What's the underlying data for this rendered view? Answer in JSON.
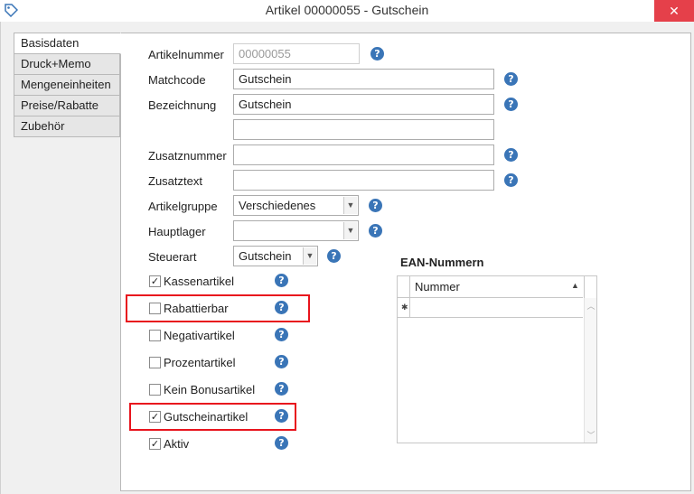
{
  "window": {
    "title": "Artikel 00000055 - Gutschein",
    "close_label": "✕"
  },
  "tabs": [
    {
      "label": "Basisdaten"
    },
    {
      "label": "Druck+Memo"
    },
    {
      "label": "Mengeneinheiten"
    },
    {
      "label": "Preise/Rabatte"
    },
    {
      "label": "Zubehör"
    }
  ],
  "form": {
    "artikelnummer": {
      "label": "Artikelnummer",
      "value": "00000055"
    },
    "matchcode": {
      "label": "Matchcode",
      "value": "Gutschein"
    },
    "bezeichnung": {
      "label": "Bezeichnung",
      "value": "Gutschein",
      "value2": ""
    },
    "zusatznummer": {
      "label": "Zusatznummer",
      "value": ""
    },
    "zusatztext": {
      "label": "Zusatztext",
      "value": ""
    },
    "artikelgruppe": {
      "label": "Artikelgruppe",
      "value": "Verschiedenes"
    },
    "hauptlager": {
      "label": "Hauptlager",
      "value": ""
    },
    "steuerart": {
      "label": "Steuerart",
      "value": "Gutschein"
    }
  },
  "checkboxes": [
    {
      "label": "Kassenartikel",
      "checked": true
    },
    {
      "label": "Rabattierbar",
      "checked": false
    },
    {
      "label": "Negativartikel",
      "checked": false
    },
    {
      "label": "Prozentartikel",
      "checked": false
    },
    {
      "label": "Kein Bonusartikel",
      "checked": false
    },
    {
      "label": "Gutscheinartikel",
      "checked": true
    },
    {
      "label": "Aktiv",
      "checked": true
    }
  ],
  "ean": {
    "title": "EAN-Nummern",
    "column": "Nummer"
  },
  "icons": {
    "help": "?",
    "check": "✓",
    "dropdown": "▼",
    "sort_asc": "▲",
    "new_row": "✱",
    "scroll_up": "︿",
    "scroll_down": "﹀"
  },
  "colors": {
    "help_blue": "#3a75b7",
    "highlight_red": "#e8141d",
    "close_red": "#e5404a"
  }
}
